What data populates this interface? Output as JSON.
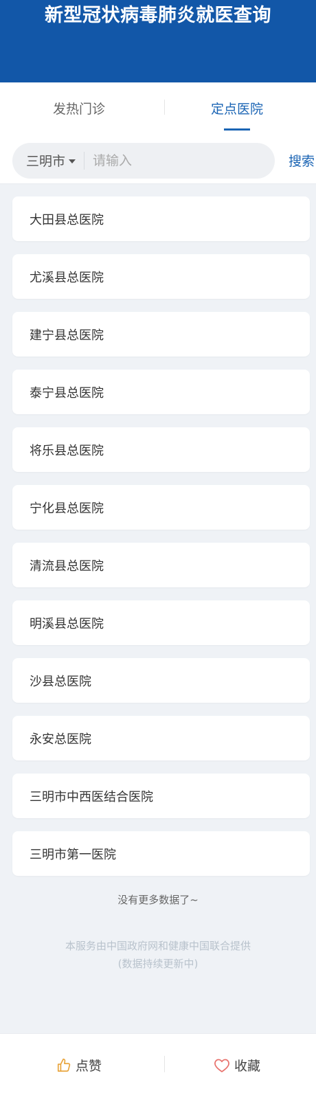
{
  "header": {
    "title": "新型冠状病毒肺炎就医查询"
  },
  "tabs": [
    {
      "label": "发热门诊",
      "active": false
    },
    {
      "label": "定点医院",
      "active": true
    }
  ],
  "search": {
    "city": "三明市",
    "placeholder": "请输入",
    "button": "搜索"
  },
  "hospitals": [
    "大田县总医院",
    "尤溪县总医院",
    "建宁县总医院",
    "泰宁县总医院",
    "将乐县总医院",
    "宁化县总医院",
    "清流县总医院",
    "明溪县总医院",
    "沙县总医院",
    "永安总医院",
    "三明市中西医结合医院",
    "三明市第一医院"
  ],
  "no_more": "没有更多数据了~",
  "footer_note": {
    "line1": "本服务由中国政府网和健康中国联合提供",
    "line2": "(数据持续更新中)"
  },
  "bottom_bar": {
    "like": "点赞",
    "favorite": "收藏",
    "like_color": "#e8a33a",
    "favorite_color": "#e8736e"
  },
  "colors": {
    "header_bg": "#1257a8",
    "accent": "#1a64b4",
    "page_bg": "#eff2f6"
  }
}
